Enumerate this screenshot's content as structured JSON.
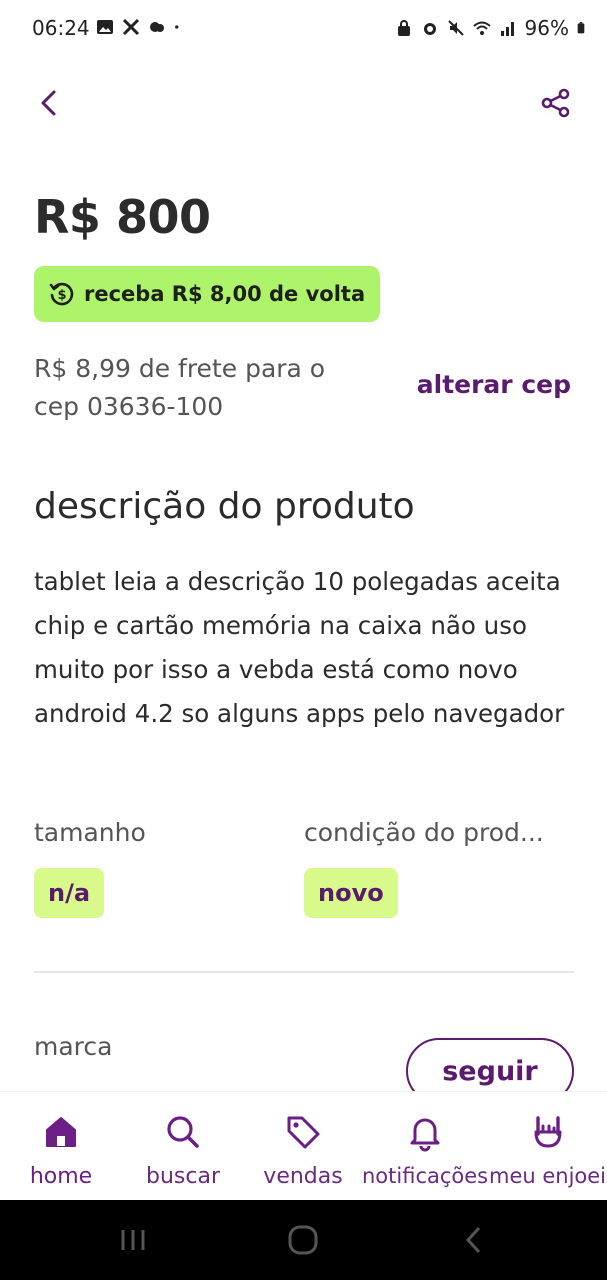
{
  "status_bar": {
    "time": "06:24",
    "battery": "96%"
  },
  "product": {
    "price": "R$ 800",
    "cashback_label": "receba R$ 8,00 de volta",
    "shipping_text": "R$ 8,99 de frete para o cep 03636-100",
    "change_cep_label": "alterar cep"
  },
  "description": {
    "title": "descrição do produto",
    "body": "tablet  leia a descrição 10 polegadas aceita chip e cartão memória na caixa não uso muito por isso a vebda está como novo android  4.2 so alguns apps pelo navegador"
  },
  "attributes": [
    {
      "label": "tamanho",
      "value": "n/a"
    },
    {
      "label": "condição do prod...",
      "value": "novo"
    }
  ],
  "brand": {
    "label": "marca",
    "follow_label": "seguir"
  },
  "bottom_nav": [
    {
      "label": "home",
      "icon": "home-icon",
      "active": true
    },
    {
      "label": "buscar",
      "icon": "search-icon",
      "active": false
    },
    {
      "label": "vendas",
      "icon": "tag-icon",
      "active": false
    },
    {
      "label": "notificações",
      "icon": "bell-icon",
      "active": false
    },
    {
      "label": "meu enjoei",
      "icon": "rock-hand-icon",
      "active": false
    }
  ],
  "colors": {
    "brand_purple": "#5a1a6e",
    "cashback_green": "#aef46b",
    "chip_green": "#d8fa8a"
  }
}
